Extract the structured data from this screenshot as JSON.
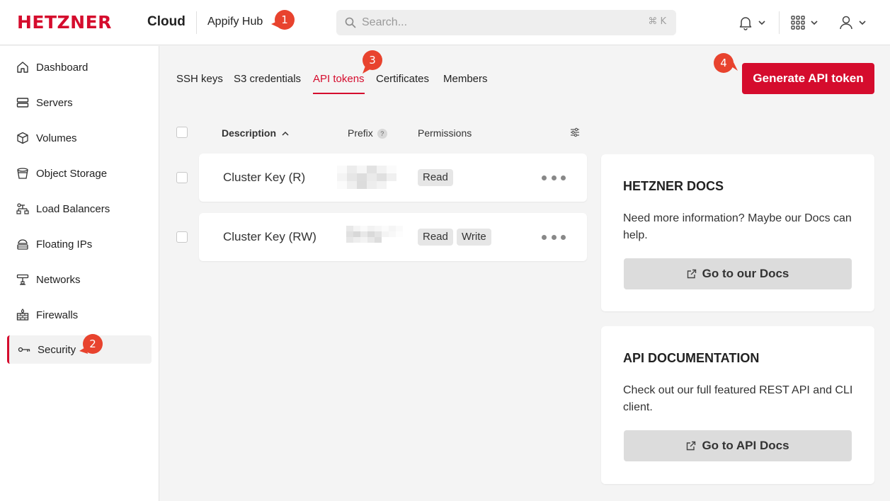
{
  "header": {
    "logo_text": "HETZNER",
    "product": "Cloud",
    "project": "Appify Hub",
    "search": {
      "placeholder": "Search...",
      "shortcut": "⌘ K"
    }
  },
  "sidebar": {
    "items": [
      {
        "label": "Dashboard",
        "icon": "home-icon"
      },
      {
        "label": "Servers",
        "icon": "server-icon"
      },
      {
        "label": "Volumes",
        "icon": "cube-icon"
      },
      {
        "label": "Object Storage",
        "icon": "bucket-icon"
      },
      {
        "label": "Load Balancers",
        "icon": "load-balancer-icon"
      },
      {
        "label": "Floating IPs",
        "icon": "floating-ip-icon"
      },
      {
        "label": "Networks",
        "icon": "network-icon"
      },
      {
        "label": "Firewalls",
        "icon": "firewall-icon"
      },
      {
        "label": "Security",
        "icon": "key-icon",
        "active": true
      }
    ]
  },
  "tabs": [
    {
      "label": "SSH keys"
    },
    {
      "label": "S3 credentials"
    },
    {
      "label": "API tokens",
      "active": true
    },
    {
      "label": "Certificates"
    },
    {
      "label": "Members"
    }
  ],
  "actions": {
    "generate_label": "Generate API token"
  },
  "table": {
    "headers": {
      "description": "Description",
      "prefix": "Prefix",
      "help": "?",
      "permissions": "Permissions"
    },
    "rows": [
      {
        "description": "Cluster Key (R)",
        "permissions": [
          "Read"
        ]
      },
      {
        "description": "Cluster Key (RW)",
        "permissions": [
          "Read",
          "Write"
        ]
      }
    ]
  },
  "cards": {
    "docs": {
      "title": "HETZNER DOCS",
      "text": "Need more information? Maybe our Docs can help.",
      "button": "Go to our Docs"
    },
    "api": {
      "title": "API DOCUMENTATION",
      "text": "Check out our full featured REST API and CLI client.",
      "button": "Go to API Docs"
    }
  },
  "markers": [
    "1",
    "2",
    "3",
    "4"
  ],
  "colors": {
    "brand": "#d50c2d",
    "marker": "#e8432e"
  }
}
